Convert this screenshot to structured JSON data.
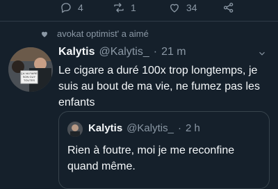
{
  "actions": {
    "reply": {
      "icon": "reply-icon",
      "count": "4"
    },
    "retweet": {
      "icon": "retweet-icon",
      "count": "1"
    },
    "like": {
      "icon": "heart-icon",
      "count": "34"
    },
    "share": {
      "icon": "share-icon"
    }
  },
  "context": {
    "icon": "heart-icon",
    "text": "avokat optimist' a aimé"
  },
  "tweet": {
    "name": "Kalytis",
    "handle": "@Kalytis_",
    "separator": "·",
    "time": "21 m",
    "text": "Le cigare a duré 100x trop longtemps, je suis au bout de ma vie, ne fumez pas les enfants",
    "avatar_sign_text": "ÇA VA FAIRE SON GUY TOUTES"
  },
  "quoted": {
    "name": "Kalytis",
    "handle": "@Kalytis_",
    "separator": "·",
    "time": "2 h",
    "text": "Rien à foutre, moi je me reconfine quand même."
  },
  "colors": {
    "background": "#15202b",
    "text": "#f5f8fa",
    "secondary": "#8b98a5",
    "border": "#38444d"
  }
}
